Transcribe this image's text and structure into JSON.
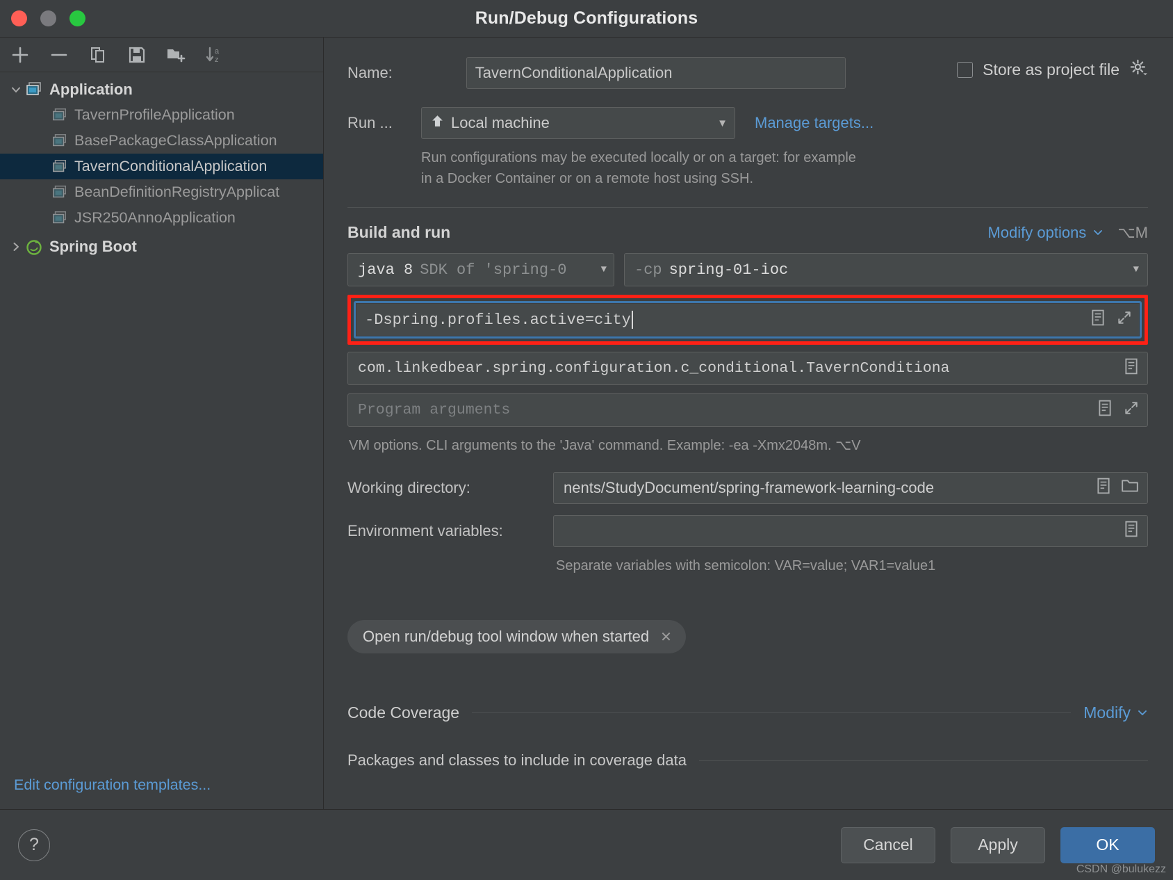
{
  "window": {
    "title": "Run/Debug Configurations"
  },
  "toolbar": {
    "icons": [
      {
        "name": "add-icon",
        "glyph": "+"
      },
      {
        "name": "remove-icon",
        "glyph": "−"
      },
      {
        "name": "copy-icon",
        "glyph": "copy"
      },
      {
        "name": "save-icon",
        "glyph": "save"
      },
      {
        "name": "new-folder-icon",
        "glyph": "folder-add"
      },
      {
        "name": "sort-alphabetically-icon",
        "glyph": "sort-az"
      }
    ]
  },
  "sidebar": {
    "groups": [
      {
        "label": "Application",
        "expanded": true,
        "children": [
          {
            "label": "TavernProfileApplication",
            "selected": false
          },
          {
            "label": "BasePackageClassApplication",
            "selected": false
          },
          {
            "label": "TavernConditionalApplication",
            "selected": true
          },
          {
            "label": "BeanDefinitionRegistryApplicat",
            "selected": false
          },
          {
            "label": "JSR250AnnoApplication",
            "selected": false
          }
        ]
      },
      {
        "label": "Spring Boot",
        "expanded": false,
        "children": []
      }
    ],
    "edit_templates_link": "Edit configuration templates..."
  },
  "main": {
    "name_label": "Name:",
    "name_value": "TavernConditionalApplication",
    "store_as_project_file": "Store as project file",
    "store_checked": false,
    "run_label": "Run ...",
    "run_target": "Local machine",
    "manage_targets": "Manage targets...",
    "run_hint_line1": "Run configurations may be executed locally or on a target: for example",
    "run_hint_line2": "in a Docker Container or on a remote host using SSH.",
    "build_and_run": "Build and run",
    "modify_options": "Modify options",
    "modify_options_shortcut": "⌥M",
    "sdk_bright": "java 8",
    "sdk_dim": "SDK of 'spring-0",
    "classpath_dim": "-cp",
    "classpath_bright": "spring-01-ioc",
    "vm_options_value": "-Dspring.profiles.active=city",
    "main_class_value": "com.linkedbear.spring.configuration.c_conditional.TavernConditiona",
    "program_arguments_placeholder": "Program arguments",
    "vm_options_hint": "VM options. CLI arguments to the 'Java' command. Example: -ea -Xmx2048m. ⌥V",
    "working_directory_label": "Working directory:",
    "working_directory_value": "nents/StudyDocument/spring-framework-learning-code",
    "environment_variables_label": "Environment variables:",
    "environment_variables_value": "",
    "environment_hint": "Separate variables with semicolon: VAR=value; VAR1=value1",
    "tool_window_chip": "Open run/debug tool window when started",
    "code_coverage_title": "Code Coverage",
    "code_coverage_modify": "Modify",
    "coverage_packages_title": "Packages and classes to include in coverage data"
  },
  "footer": {
    "help": "?",
    "cancel": "Cancel",
    "apply": "Apply",
    "ok": "OK",
    "watermark": "CSDN @bulukezz"
  },
  "colors": {
    "accent_blue": "#3b6ea5",
    "link_blue": "#5b9bd5",
    "selection": "#0d293e",
    "annotation_red": "#ff2116",
    "focus_ring": "#3d76ab"
  }
}
